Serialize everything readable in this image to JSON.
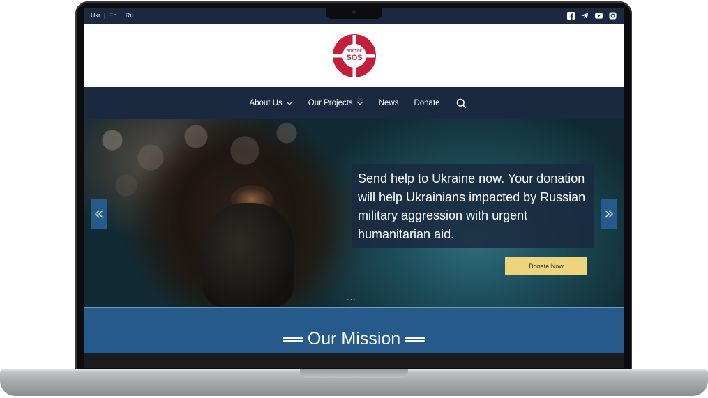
{
  "languages": {
    "items": [
      "Ukr",
      "En",
      "Ru"
    ],
    "active": "En",
    "active_color": "#e8c64b"
  },
  "socials": {
    "icons": [
      "facebook-icon",
      "telegram-icon",
      "youtube-icon",
      "instagram-icon"
    ]
  },
  "logo": {
    "small_text": "ВОСТОК",
    "main_text": "SOS",
    "color": "#c41e3a"
  },
  "nav": {
    "items": [
      {
        "label": "About Us",
        "dropdown": true
      },
      {
        "label": "Our Projects",
        "dropdown": true
      },
      {
        "label": "News",
        "dropdown": false
      },
      {
        "label": "Donate",
        "dropdown": false
      }
    ],
    "search_icon": "search-icon"
  },
  "hero": {
    "text": "Send help to Ukraine now. Your donation will help Ukrainians impacted by Russian military aggression with urgent humanitarian aid.",
    "button_label": "Donate Now",
    "button_color": "#eed57c",
    "prev_icon": "chevron-double-left-icon",
    "next_icon": "chevron-double-right-icon",
    "dots": "..."
  },
  "mission": {
    "title": "Our Mission"
  },
  "colors": {
    "nav_bg": "#1a2940",
    "mission_bg": "#255a8a",
    "arrow_bg": "#265a8c"
  }
}
